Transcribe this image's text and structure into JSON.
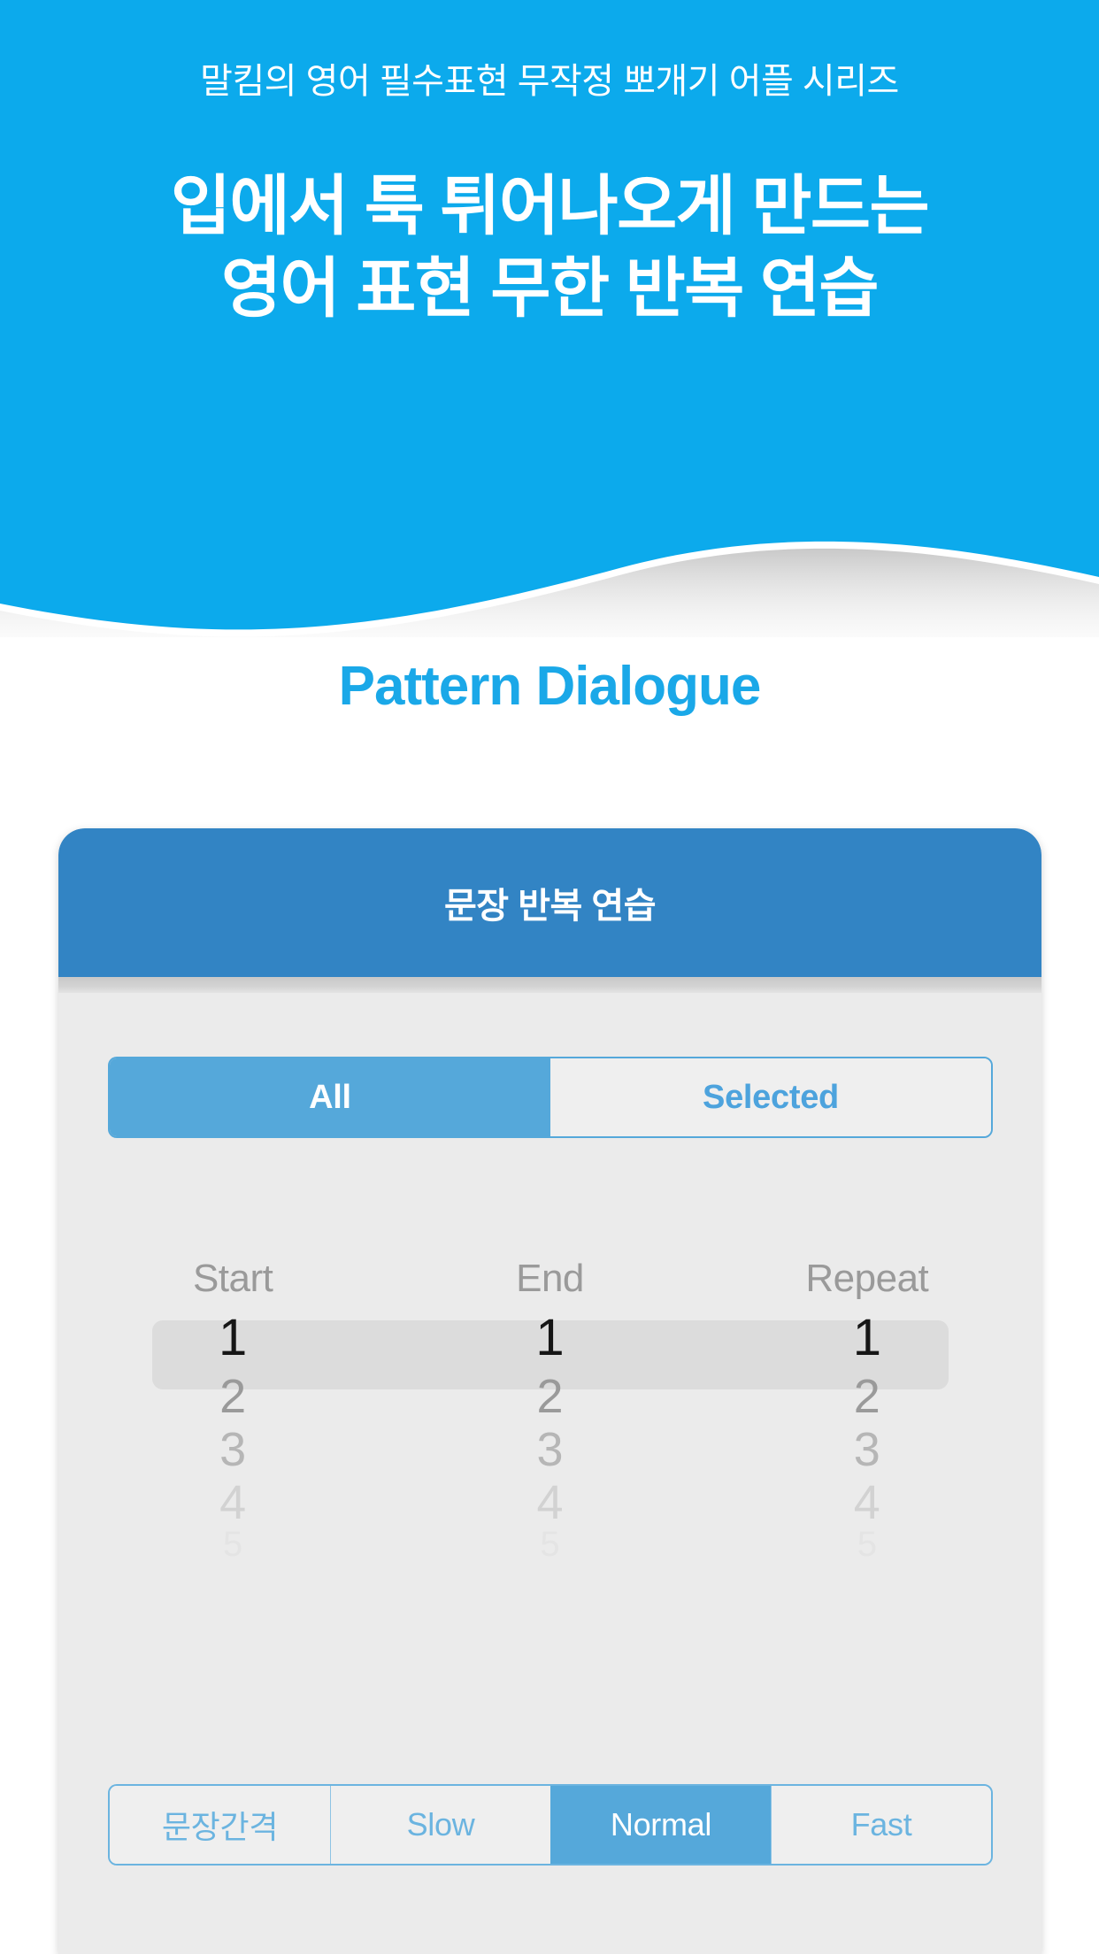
{
  "colors": {
    "hero_blue": "#0caaec",
    "section_title_blue": "#1aa8e8",
    "card_header_blue": "#3284c4",
    "segment_active_blue": "#55a8da",
    "segment_inactive_bg": "#efefef",
    "segment_border_blue": "#6bb4e0",
    "card_body_bg": "#ebebeb",
    "picker_band_gray": "#dcdcdc",
    "page_bg": "#ffffff"
  },
  "hero": {
    "kicker": "말킴의 영어 필수표현 무작정 뽀개기 어플 시리즈",
    "title_line1": "입에서 툭 튀어나오게 만드는",
    "title_line2": "영어 표현 무한 반복 연습"
  },
  "section": {
    "title": "Pattern Dialogue"
  },
  "card": {
    "header_title": "문장 반복 연습",
    "scope_segments": [
      {
        "label": "All",
        "selected": true
      },
      {
        "label": "Selected",
        "selected": false
      }
    ],
    "pickers": [
      {
        "label": "Start",
        "selected_value": "1",
        "options": [
          "1",
          "2",
          "3",
          "4",
          "5"
        ]
      },
      {
        "label": "End",
        "selected_value": "1",
        "options": [
          "1",
          "2",
          "3",
          "4",
          "5"
        ]
      },
      {
        "label": "Repeat",
        "selected_value": "1",
        "options": [
          "1",
          "2",
          "3",
          "4",
          "5"
        ]
      }
    ],
    "speed_segments": [
      {
        "label": "문장간격",
        "selected": false
      },
      {
        "label": "Slow",
        "selected": false
      },
      {
        "label": "Normal",
        "selected": true
      },
      {
        "label": "Fast",
        "selected": false
      }
    ]
  }
}
